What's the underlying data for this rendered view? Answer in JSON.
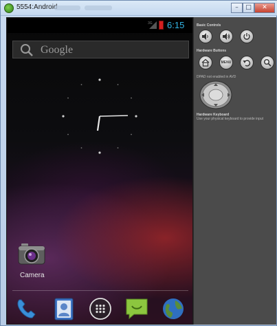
{
  "window": {
    "title": "5554:Android"
  },
  "screen": {
    "status_time": "6:15",
    "search_label": "Google",
    "shortcut_label": "Camera"
  },
  "panel": {
    "basic_controls": "Basic Controls",
    "hardware_buttons": "Hardware Buttons",
    "menu_label": "MENU",
    "dpad_note": "DPAD not enabled in AVD",
    "hardware_keyboard": "Hardware Keyboard",
    "keyboard_note": "Use your physical keyboard to provide input"
  },
  "icons": {
    "app": "android-emulator-icon",
    "minimize": "minimize-icon",
    "maximize": "maximize-icon",
    "close": "close-icon",
    "volume_down": "volume-down-icon",
    "volume_up": "volume-up-icon",
    "power": "power-icon",
    "home": "home-icon",
    "back": "back-icon",
    "search": "search-icon"
  },
  "colors": {
    "status_accent": "#33b5e5",
    "battery": "#d21f1f",
    "panel_bg": "#4b4b4b"
  }
}
